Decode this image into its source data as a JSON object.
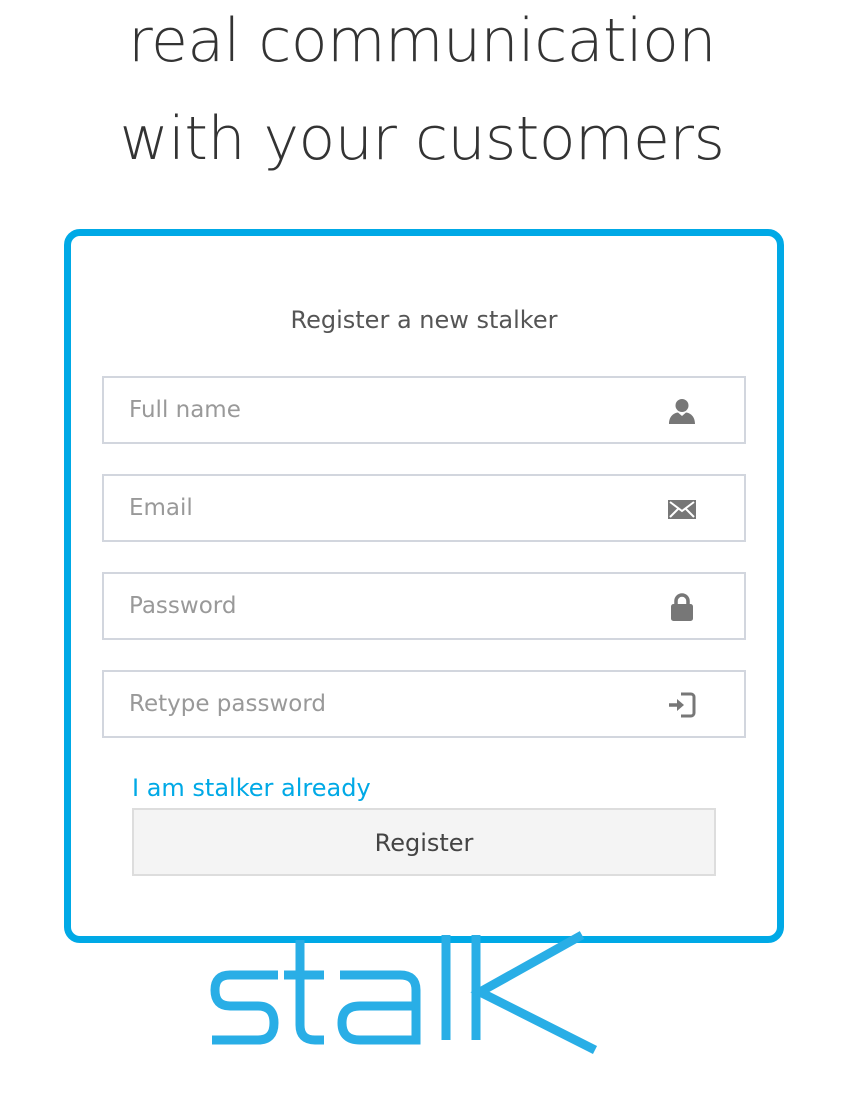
{
  "headline": {
    "line1": "real communication",
    "line2": "with your customers"
  },
  "register_form": {
    "title": "Register a new stalker",
    "fields": [
      {
        "placeholder": "Full name",
        "icon": "user-icon"
      },
      {
        "placeholder": "Email",
        "icon": "envelope-icon"
      },
      {
        "placeholder": "Password",
        "icon": "lock-icon"
      },
      {
        "placeholder": "Retype password",
        "icon": "login-icon"
      }
    ],
    "login_link": "I am stalker already",
    "submit_label": "Register"
  },
  "logo": {
    "text": "stalk",
    "color": "#29aee6"
  },
  "colors": {
    "accent": "#00a9e6",
    "field_border": "#d2d6de",
    "icon": "#777777"
  }
}
